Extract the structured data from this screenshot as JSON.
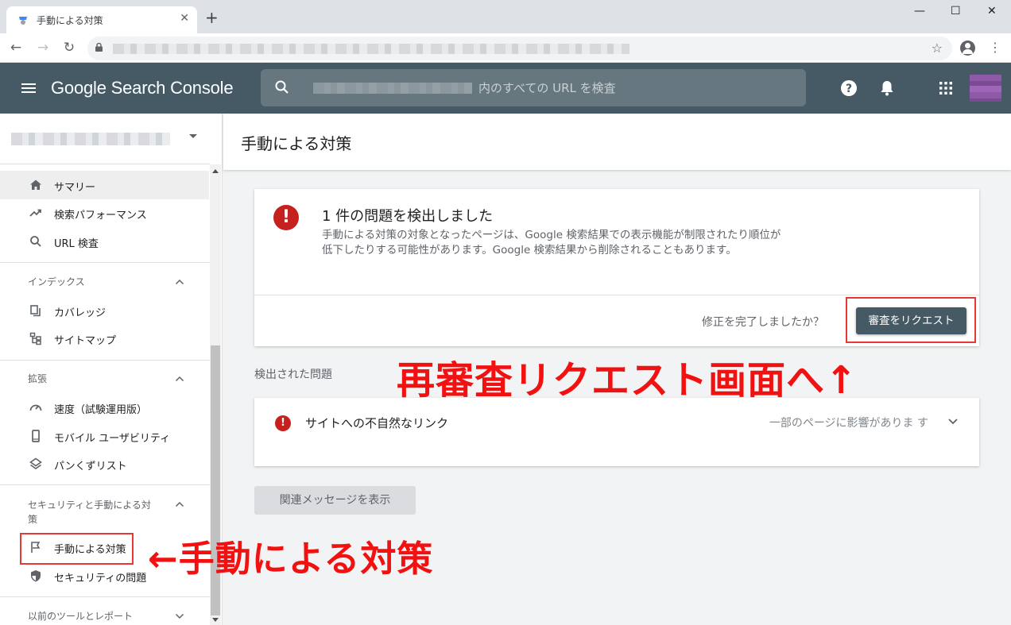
{
  "browser": {
    "tab_title": "手動による対策",
    "tab_close": "✕",
    "new_tab": "+",
    "window_controls": {
      "minimize": "—",
      "maximize": "☐",
      "close": "✕"
    },
    "nav": {
      "back": "←",
      "forward": "→",
      "reload": "↻"
    },
    "bookmark_star": "☆",
    "menu": "⋮"
  },
  "header": {
    "brand": "Google Search Console",
    "search_placeholder": "内のすべての URL を検査"
  },
  "sidebar": {
    "top_items": [
      {
        "label": "サマリー",
        "icon": "home-icon"
      },
      {
        "label": "検索パフォーマンス",
        "icon": "trending-up-icon"
      },
      {
        "label": "URL 検査",
        "icon": "search-icon"
      }
    ],
    "sections": [
      {
        "title": "インデックス",
        "items": [
          {
            "label": "カバレッジ",
            "icon": "file-copy-icon"
          },
          {
            "label": "サイトマップ",
            "icon": "sitemap-icon"
          }
        ]
      },
      {
        "title": "拡張",
        "items": [
          {
            "label": "速度（試験運用版）",
            "icon": "speed-icon"
          },
          {
            "label": "モバイル ユーザビリティ",
            "icon": "smartphone-icon"
          },
          {
            "label": "パンくずリスト",
            "icon": "layers-icon"
          }
        ]
      },
      {
        "title": "セキュリティと手動による対策",
        "items": [
          {
            "label": "手動による対策",
            "icon": "flag-icon"
          },
          {
            "label": "セキュリティの問題",
            "icon": "shield-icon"
          }
        ]
      },
      {
        "title": "以前のツールとレポート"
      }
    ]
  },
  "main": {
    "page_title": "手動による対策",
    "summary_card": {
      "heading": "1 件の問題を検出しました",
      "description": "手動による対策の対象となったページは、Google 検索結果での表示機能が制限されたり順位が低下したりする可能性があります。Google 検索結果から削除されることもあります。",
      "fix_question": "修正を完了しましたか？",
      "review_button": "審査をリクエスト"
    },
    "detected_title": "検出された問題",
    "issue": {
      "name": "サイトへの不自然なリンク",
      "impact": "一部のページに影響がありま す"
    },
    "messages_button": "関連メッセージを表示"
  },
  "annotations": {
    "review": "再審査リクエスト画面へ↑",
    "manual": "←手動による対策"
  },
  "colors": {
    "header_bg": "#455a64",
    "error_red": "#c5221f",
    "annotation_red": "#f21111"
  }
}
